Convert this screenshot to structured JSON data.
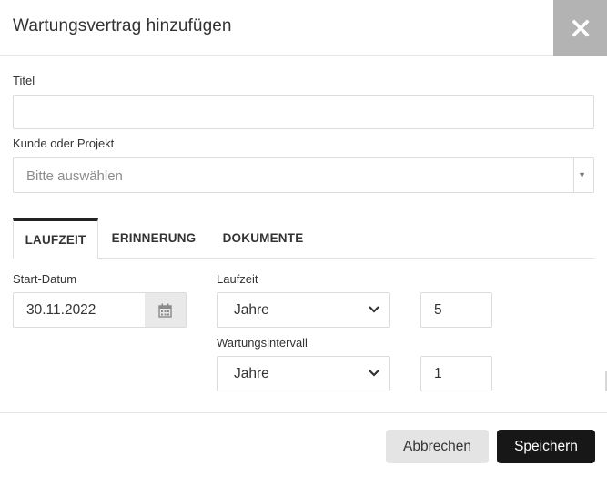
{
  "dialog": {
    "title": "Wartungsvertrag hinzufügen",
    "close_icon": "close-icon"
  },
  "form": {
    "title_label": "Titel",
    "title_value": "",
    "customer_label": "Kunde oder Projekt",
    "customer_placeholder": "Bitte auswählen"
  },
  "tabs": [
    {
      "label": "LAUFZEIT",
      "active": true
    },
    {
      "label": "ERINNERUNG",
      "active": false
    },
    {
      "label": "DOKUMENTE",
      "active": false
    }
  ],
  "laufzeit_tab": {
    "start_label": "Start-Datum",
    "start_value": "30.11.2022",
    "duration_label": "Laufzeit",
    "duration_unit": "Jahre",
    "duration_value": "5",
    "interval_label": "Wartungsintervall",
    "interval_unit": "Jahre",
    "interval_value": "1"
  },
  "footer": {
    "cancel_label": "Abbrechen",
    "save_label": "Speichern"
  },
  "colors": {
    "close_bg": "#b3b3b3",
    "primary_button": "#171717",
    "secondary_button": "#e4e4e4",
    "border": "#dcdcdc"
  }
}
